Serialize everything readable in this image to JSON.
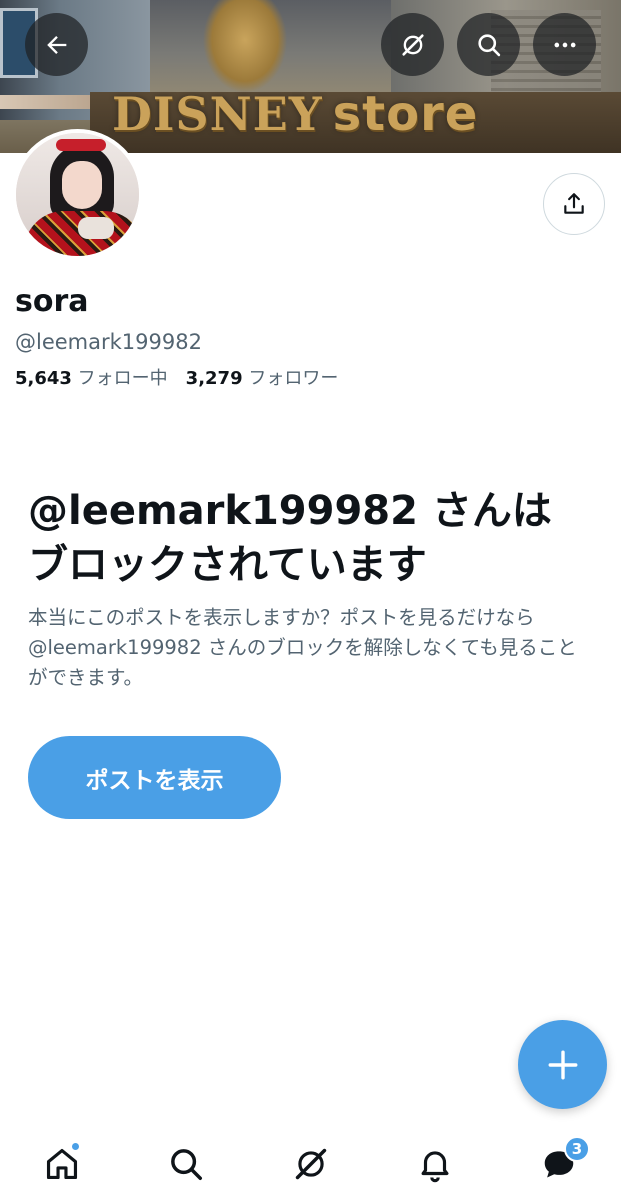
{
  "banner": {
    "sign_brand": "DISNEY",
    "sign_word": "store"
  },
  "header": {
    "back_icon": "arrow-left-icon",
    "grok_icon": "grok-icon",
    "search_icon": "search-icon",
    "more_icon": "more-horizontal-icon"
  },
  "profile": {
    "display_name": "sora",
    "handle": "@leemark199982",
    "following_count": "5,643",
    "following_label": "フォロー中",
    "followers_count": "3,279",
    "followers_label": "フォロワー",
    "share_icon": "share-icon"
  },
  "blocked": {
    "title": "@leemark199982 さんはブロックされています",
    "description": "本当にこのポストを表示しますか？ポストを見るだけなら @leemark199982 さんのブロックを解除しなくても見ることができます。",
    "button_label": "ポストを表示"
  },
  "fab": {
    "icon": "plus-icon"
  },
  "bottom_nav": {
    "items": [
      {
        "name": "home",
        "icon": "home-icon",
        "has_dot": true
      },
      {
        "name": "search",
        "icon": "search-icon"
      },
      {
        "name": "grok",
        "icon": "grok-icon"
      },
      {
        "name": "notifications",
        "icon": "bell-icon"
      },
      {
        "name": "messages",
        "icon": "messages-icon",
        "badge": "3"
      }
    ]
  },
  "colors": {
    "accent": "#4a9fe6",
    "text_primary": "#0f1419",
    "text_secondary": "#536471"
  }
}
